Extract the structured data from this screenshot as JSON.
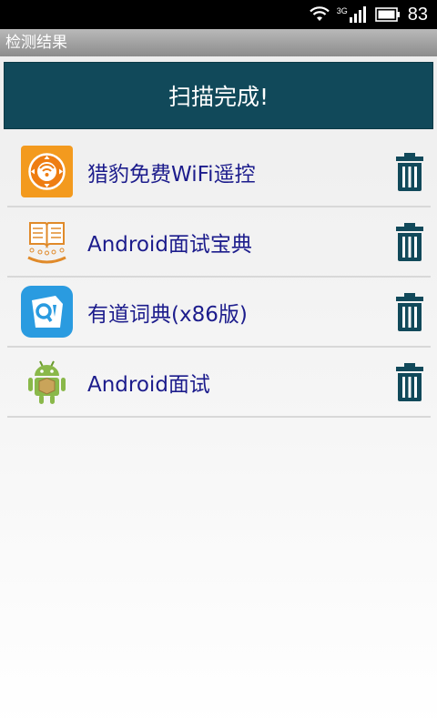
{
  "status_bar": {
    "network_type": "3G",
    "battery": "83",
    "icons": [
      "wifi-icon",
      "signal-icon",
      "battery-icon"
    ]
  },
  "title_bar": {
    "title": "检测结果"
  },
  "banner": {
    "text": "扫描完成!"
  },
  "apps": [
    {
      "name": "猎豹免费WiFi遥控",
      "icon": "wifi-remote-app-icon"
    },
    {
      "name": "Android面试宝典",
      "icon": "book-app-icon"
    },
    {
      "name": "有道词典(x86版)",
      "icon": "dictionary-app-icon"
    },
    {
      "name": "Android面试",
      "icon": "android-robot-app-icon"
    }
  ],
  "colors": {
    "banner": "#11495a",
    "app_name": "#1c1c8c",
    "trash": "#11495a"
  }
}
